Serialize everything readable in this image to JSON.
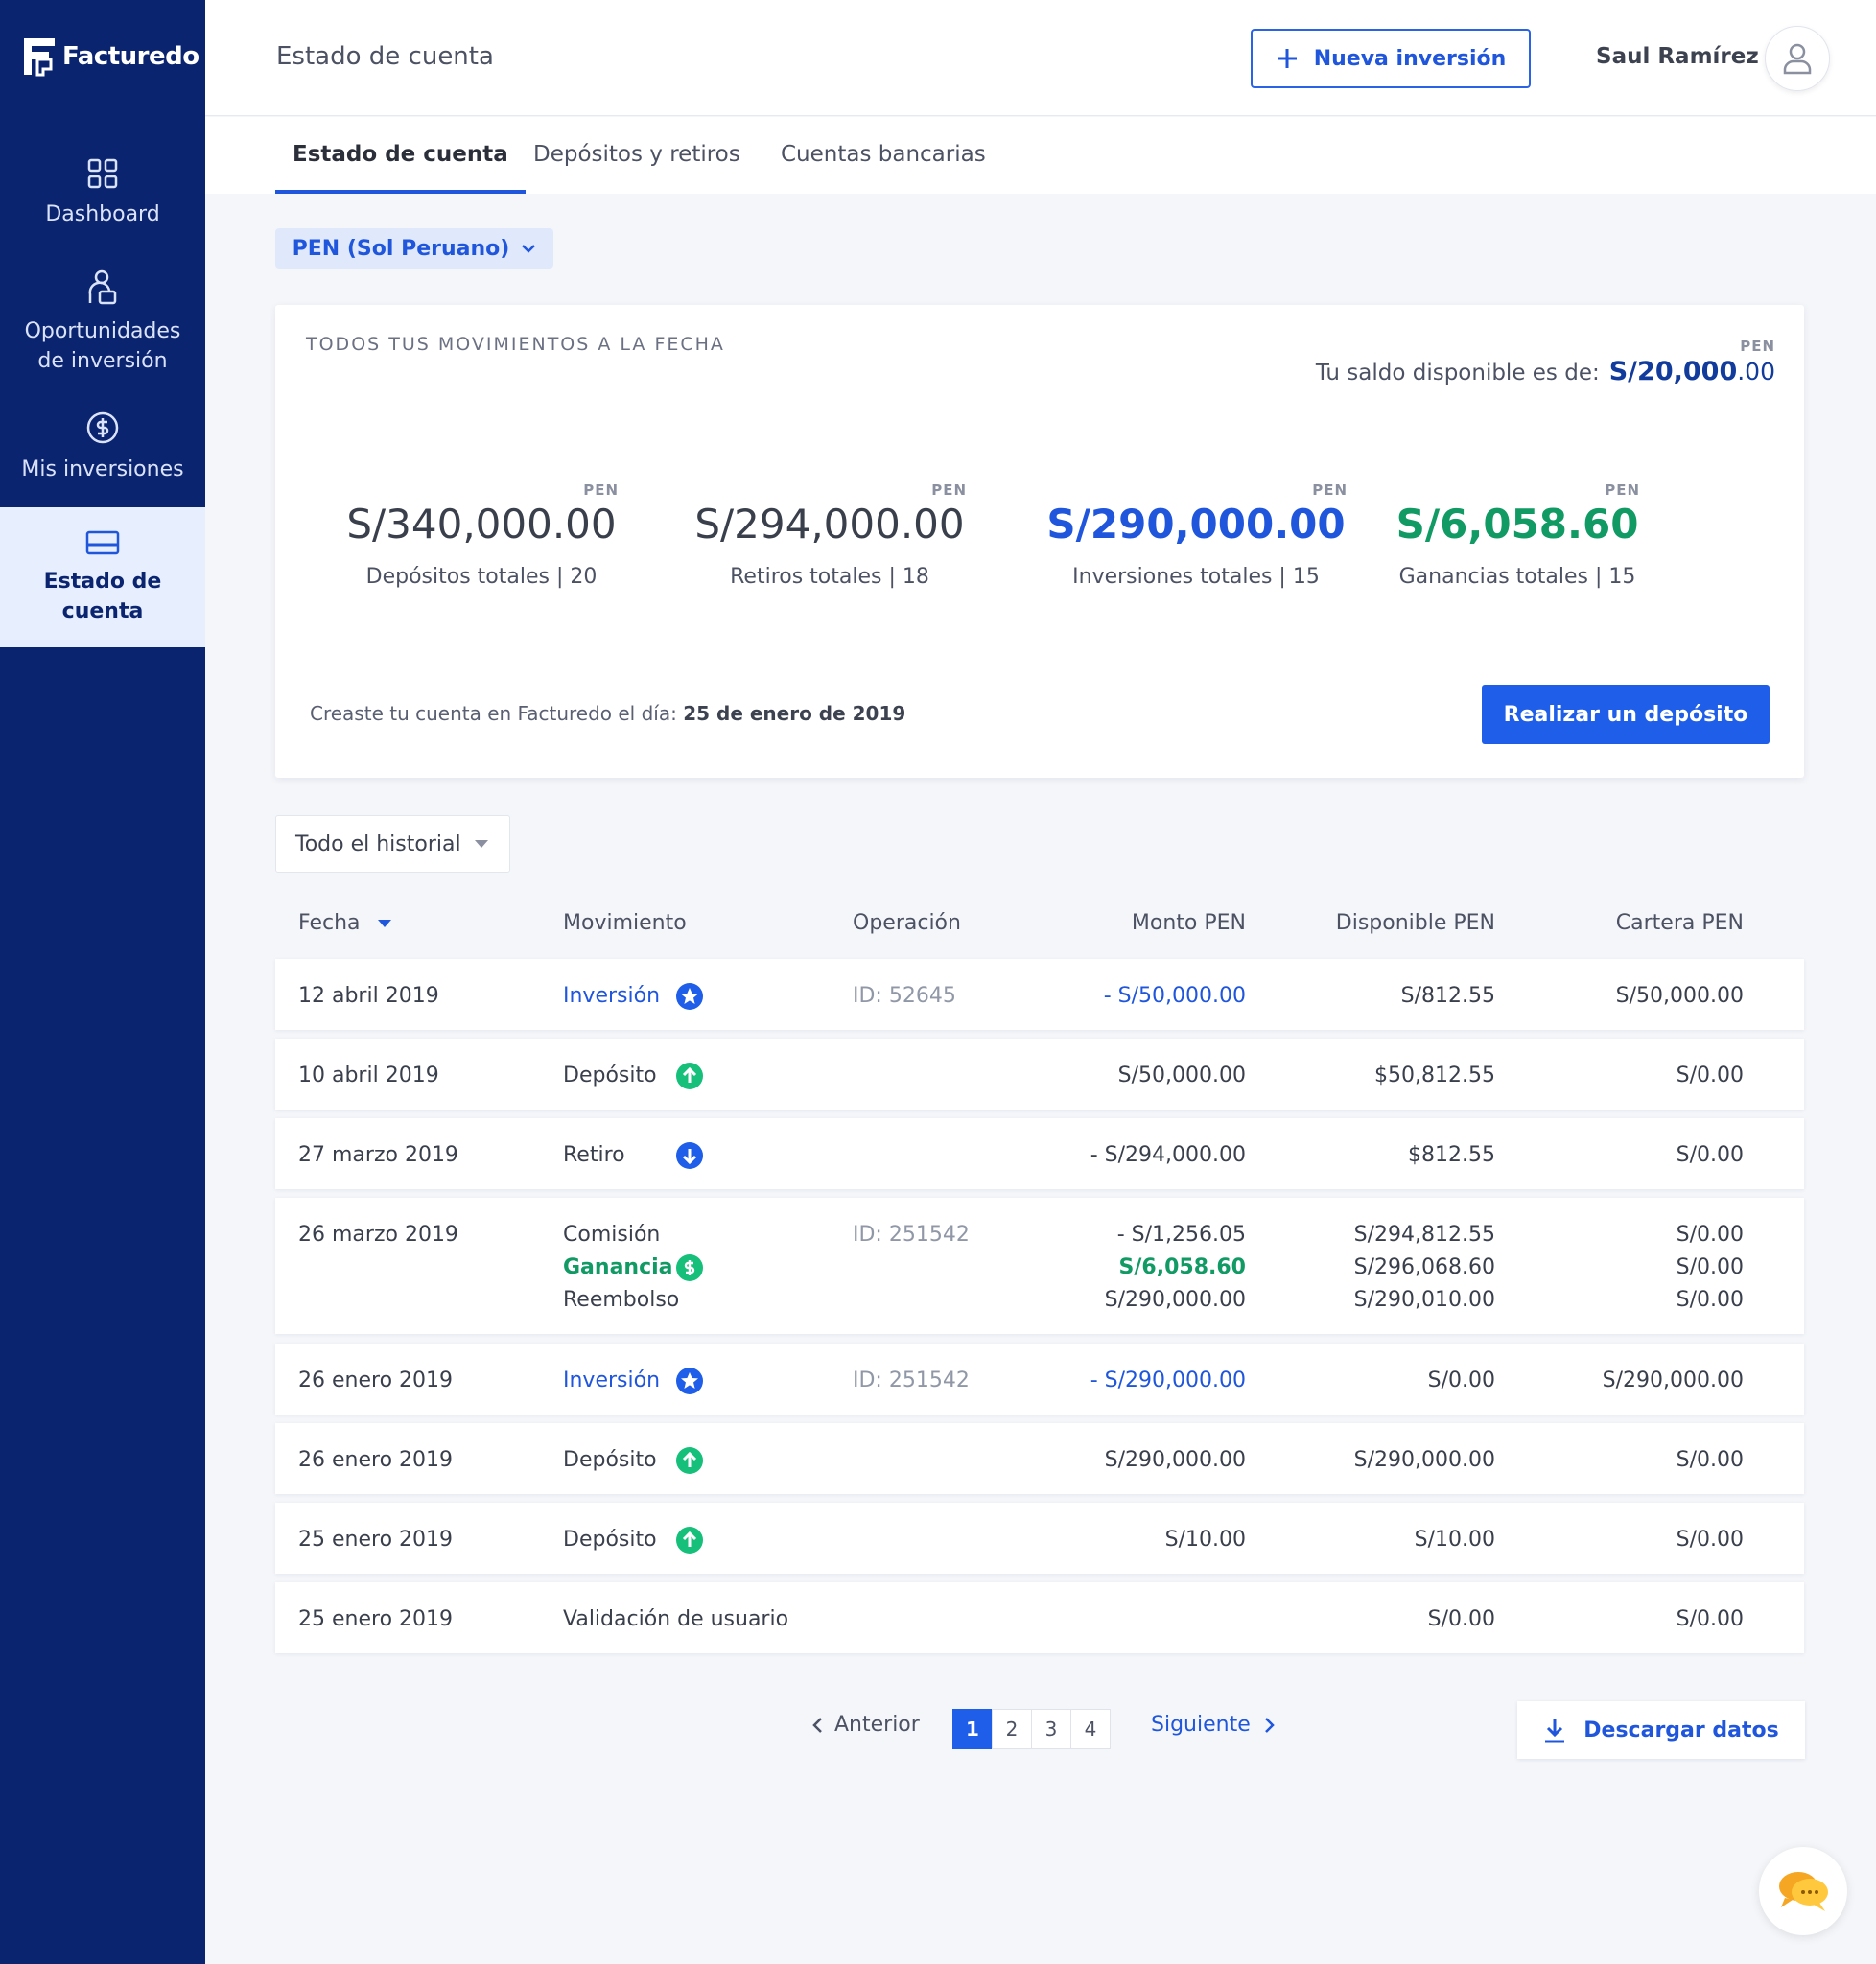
{
  "brand": {
    "name": "Facturedo"
  },
  "sidebar": {
    "items": [
      {
        "label": "Dashboard",
        "icon": "grid-icon"
      },
      {
        "label": "Oportunidades de inversión",
        "icon": "person-invest-icon"
      },
      {
        "label": "Mis inversiones",
        "icon": "dollar-circle-icon"
      },
      {
        "label": "Estado de cuenta",
        "icon": "card-icon",
        "active": true
      }
    ]
  },
  "header": {
    "title": "Estado de cuenta",
    "new_investment_label": "Nueva inversión",
    "user_name": "Saul Ramírez"
  },
  "tabs": [
    {
      "label": "Estado de cuenta",
      "active": true
    },
    {
      "label": "Depósitos y retiros"
    },
    {
      "label": "Cuentas bancarias"
    }
  ],
  "currency_selector": {
    "value": "PEN (Sol Peruano)"
  },
  "summary": {
    "eyebrow": "TODOS TUS MOVIMIENTOS A LA FECHA",
    "balance_currency": "PEN",
    "balance_label": "Tu saldo disponible es de:",
    "balance_main": "S/20,000",
    "balance_cents": ".00",
    "stats": [
      {
        "currency": "PEN",
        "amount": "S/340,000.00",
        "label": "Depósitos totales | 20",
        "style": "normal"
      },
      {
        "currency": "PEN",
        "amount": "S/294,000.00",
        "label": "Retiros totales | 18",
        "style": "normal"
      },
      {
        "currency": "PEN",
        "amount": "S/290,000.00",
        "label": "Inversiones totales | 15",
        "style": "blue"
      },
      {
        "currency": "PEN",
        "amount": "S/6,058.60",
        "label": "Ganancias totales | 15",
        "style": "green"
      }
    ],
    "created_prefix": "Creaste tu cuenta en Facturedo el día:",
    "created_date": "25 de enero de 2019",
    "deposit_button": "Realizar un depósito"
  },
  "filter": {
    "value": "Todo el historial"
  },
  "table": {
    "columns": [
      "Fecha",
      "Movimiento",
      "Operación",
      "Monto PEN",
      "Disponible PEN",
      "Cartera PEN"
    ],
    "rows": [
      {
        "fecha": "12 abril 2019",
        "movimiento": "Inversión",
        "operacion": "ID: 52645",
        "monto": "- S/50,000.00",
        "disponible": "S/812.55",
        "cartera": "S/50,000.00"
      },
      {
        "fecha": "10 abril 2019",
        "movimiento": "Depósito",
        "operacion": "",
        "monto": "S/50,000.00",
        "disponible": "$50,812.55",
        "cartera": "S/0.00"
      },
      {
        "fecha": "27 marzo 2019",
        "movimiento": "Retiro",
        "operacion": "",
        "monto": "- S/294,000.00",
        "disponible": "$812.55",
        "cartera": "S/0.00"
      },
      {
        "fecha": "26 marzo 2019",
        "movimiento": "Comisión",
        "movimiento2": "Ganancia",
        "movimiento3": "Reembolso",
        "operacion": "ID: 251542",
        "monto": "- S/1,256.05",
        "monto2": "S/6,058.60",
        "monto3": "S/290,000.00",
        "disponible": "S/294,812.55",
        "disponible2": "S/296,068.60",
        "disponible3": "S/290,010.00",
        "cartera": "S/0.00",
        "cartera2": "S/0.00",
        "cartera3": "S/0.00"
      },
      {
        "fecha": "26 enero 2019",
        "movimiento": "Inversión",
        "operacion": "ID: 251542",
        "monto": "- S/290,000.00",
        "disponible": "S/0.00",
        "cartera": "S/290,000.00"
      },
      {
        "fecha": "26 enero 2019",
        "movimiento": "Depósito",
        "operacion": "",
        "monto": "S/290,000.00",
        "disponible": "S/290,000.00",
        "cartera": "S/0.00"
      },
      {
        "fecha": "25 enero 2019",
        "movimiento": "Depósito",
        "operacion": "",
        "monto": "S/10.00",
        "disponible": "S/10.00",
        "cartera": "S/0.00"
      },
      {
        "fecha": "25 enero 2019",
        "movimiento": "Validación de usuario",
        "operacion": "",
        "monto": "",
        "disponible": "S/0.00",
        "cartera": "S/0.00"
      }
    ]
  },
  "pagination": {
    "prev": "Anterior",
    "next": "Siguiente",
    "pages": [
      "1",
      "2",
      "3",
      "4"
    ],
    "current": "1"
  },
  "download_label": "Descargar datos",
  "colors": {
    "navy": "#0b2470",
    "accent": "#1f56dc",
    "green": "#119a63"
  }
}
